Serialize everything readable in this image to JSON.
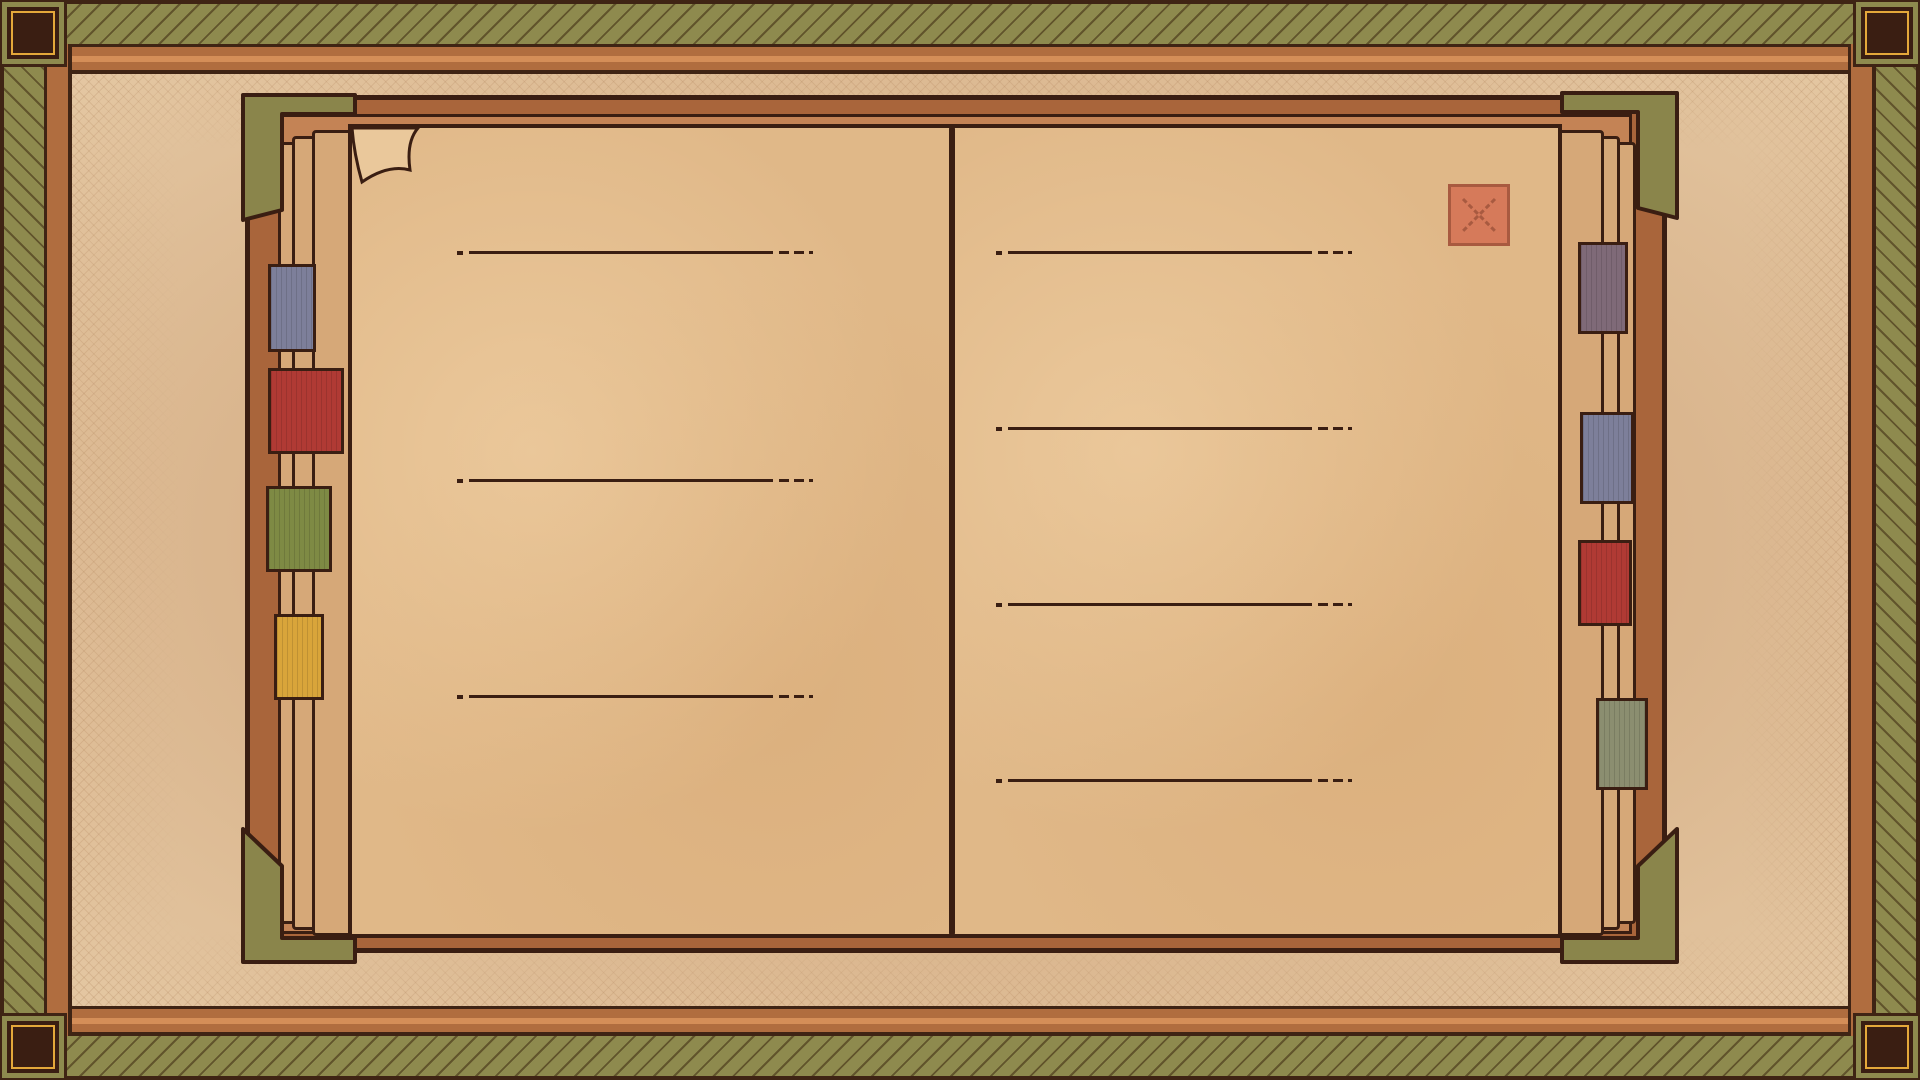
{
  "screen": "journal",
  "colors": {
    "frame_olive": "#8e8a4e",
    "frame_brown": "#b06d3f",
    "outline": "#3a1e12",
    "corner_accent": "#e4a83a",
    "paper": "#e0b888",
    "mat": "#d9b48c",
    "close_button": "#d67a5a"
  },
  "left_tabs": [
    {
      "name": "tab-blue",
      "color": "#7d7f9a"
    },
    {
      "name": "tab-red",
      "color": "#b03a34"
    },
    {
      "name": "tab-green",
      "color": "#7e8a44"
    },
    {
      "name": "tab-yellow",
      "color": "#d9a53a"
    }
  ],
  "right_tabs": [
    {
      "name": "tab-purple",
      "color": "#7f6a78"
    },
    {
      "name": "tab-blue",
      "color": "#7d7f9a"
    },
    {
      "name": "tab-red",
      "color": "#b03a34"
    },
    {
      "name": "tab-sage",
      "color": "#8b8e70"
    }
  ],
  "left_page_lines": [
    "",
    "",
    ""
  ],
  "right_page_lines": [
    "",
    "",
    "",
    ""
  ],
  "close_icon": "x-icon"
}
